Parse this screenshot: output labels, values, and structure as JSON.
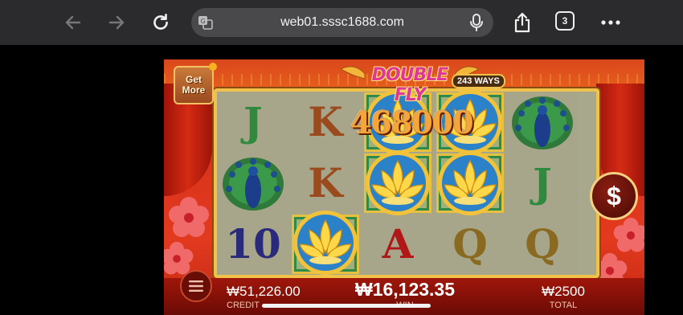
{
  "browser": {
    "url": "web01.sssc1688.com",
    "tab_count": "3",
    "icons": [
      "back-arrow-icon",
      "forward-arrow-icon",
      "reload-icon",
      "translate-icon",
      "microphone-icon",
      "share-icon",
      "tabs-icon",
      "more-icon"
    ]
  },
  "game": {
    "title": "DOUBLE FLY",
    "ways_label": "243 WAYS",
    "get_more_line1": "Get",
    "get_more_line2": "More",
    "win_popup": "468000",
    "coin_symbol": "$",
    "reels": [
      [
        "J",
        "peacock",
        "10"
      ],
      [
        "K",
        "K",
        "lotus"
      ],
      [
        "lotus",
        "lotus",
        "A"
      ],
      [
        "lotus",
        "lotus",
        "Q"
      ],
      [
        "peacock",
        "J",
        "Q"
      ]
    ],
    "winning_cells": [
      [
        1,
        2
      ],
      [
        2,
        0
      ],
      [
        2,
        1
      ],
      [
        3,
        0
      ],
      [
        3,
        1
      ]
    ]
  },
  "bottom": {
    "credit_value": "₩51,226.00",
    "credit_label": "CREDIT",
    "win_value": "₩16,123.35",
    "win_label": "WIN",
    "total_value": "₩2500",
    "total_label": "TOTAL"
  },
  "colors": {
    "letter_J": "#2f8a3e",
    "letter_K": "#9a4a1c",
    "letter_10": "#2a2a7a",
    "letter_A": "#b01818",
    "letter_Q": "#8a6a20"
  }
}
